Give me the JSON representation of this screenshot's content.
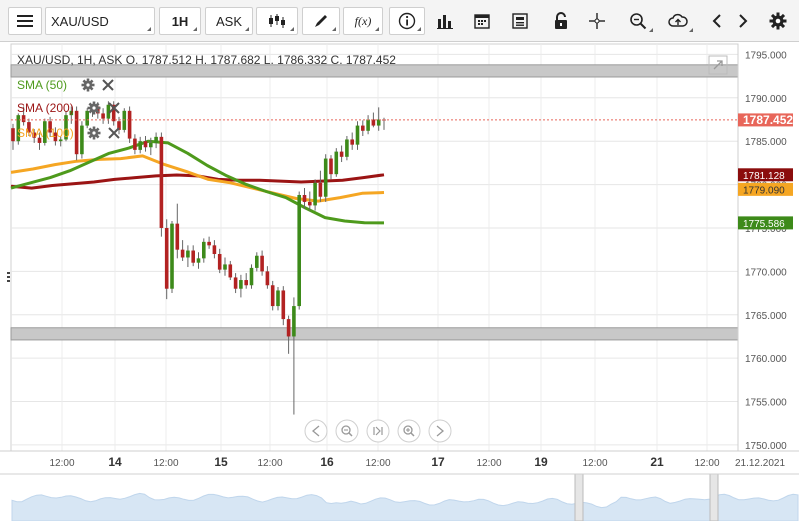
{
  "toolbar": {
    "symbol": "XAU/USD",
    "timeframe": "1H",
    "price_type": "ASK",
    "fx_label": "f(x)",
    "icons": [
      "menu-icon",
      "candles-icon",
      "pencil-icon",
      "function-icon",
      "info-icon",
      "bar-chart-icon",
      "calendar-icon",
      "news-icon",
      "lock-icon",
      "crosshair-icon",
      "zoom-icon",
      "cloud-upload-icon",
      "chevron-left-icon",
      "chevron-right-icon",
      "gear-icon"
    ]
  },
  "chart": {
    "header": "XAU/USD, 1H, ASK",
    "ohlc": "O. 1787.512 H. 1787.682 L. 1786.332 C. 1787.452",
    "indicators": [
      {
        "label": "SMA (50)",
        "color": "#4e9a1c"
      },
      {
        "label": "SMA (200)",
        "color": "#9b1414"
      },
      {
        "label": "SMA (100)",
        "color": "#f5a623"
      }
    ],
    "price_badges": [
      {
        "value": "1787.452",
        "bg": "#e8665a",
        "fg": "#ffffff"
      },
      {
        "value": "1781.128",
        "bg": "#8b0d0d",
        "fg": "#ffffff"
      },
      {
        "value": "1779.090",
        "bg": "#f5a623",
        "fg": "#333333"
      },
      {
        "value": "1775.586",
        "bg": "#3d8a1a",
        "fg": "#ffffff"
      }
    ],
    "y_ticks": [
      "1795.000",
      "1790.000",
      "1785.000",
      "1780.000",
      "1775.000",
      "1770.000",
      "1765.000",
      "1760.000",
      "1755.000",
      "1750.000"
    ],
    "x_ticks": [
      {
        "label": "12:00",
        "bold": false
      },
      {
        "label": "14",
        "bold": true
      },
      {
        "label": "12:00",
        "bold": false
      },
      {
        "label": "15",
        "bold": true
      },
      {
        "label": "12:00",
        "bold": false
      },
      {
        "label": "16",
        "bold": true
      },
      {
        "label": "12:00",
        "bold": false
      },
      {
        "label": "17",
        "bold": true
      },
      {
        "label": "12:00",
        "bold": false
      },
      {
        "label": "19",
        "bold": true
      },
      {
        "label": "12:00",
        "bold": false
      },
      {
        "label": "21",
        "bold": true
      },
      {
        "label": "12:00",
        "bold": false
      },
      {
        "label": "21.12.2021",
        "bold": false
      }
    ]
  },
  "chart_data": {
    "type": "candlestick",
    "symbol": "XAU/USD",
    "interval": "1H",
    "ylim": [
      1750,
      1796
    ],
    "bullish_color": "#3d8a1a",
    "bearish_color": "#b22222",
    "candles": [
      [
        1786.5,
        1787.0,
        1784.0,
        1785.0
      ],
      [
        1785.0,
        1788.2,
        1784.6,
        1788.0
      ],
      [
        1788.0,
        1789.0,
        1786.8,
        1787.2
      ],
      [
        1787.2,
        1787.6,
        1785.6,
        1786.0
      ],
      [
        1786.0,
        1786.4,
        1784.8,
        1785.4
      ],
      [
        1785.4,
        1786.0,
        1784.0,
        1784.8
      ],
      [
        1784.8,
        1787.6,
        1784.5,
        1787.3
      ],
      [
        1787.3,
        1787.8,
        1785.5,
        1786.0
      ],
      [
        1786.0,
        1786.6,
        1784.5,
        1785.0
      ],
      [
        1785.0,
        1785.5,
        1784.4,
        1785.2
      ],
      [
        1785.2,
        1788.5,
        1785.0,
        1788.0
      ],
      [
        1788.0,
        1789.0,
        1787.0,
        1788.5
      ],
      [
        1788.5,
        1789.0,
        1782.8,
        1783.5
      ],
      [
        1783.5,
        1787.3,
        1783.0,
        1786.8
      ],
      [
        1786.8,
        1788.8,
        1786.5,
        1788.5
      ],
      [
        1788.5,
        1789.3,
        1787.8,
        1789.0
      ],
      [
        1789.0,
        1789.5,
        1787.6,
        1788.2
      ],
      [
        1788.2,
        1788.8,
        1787.0,
        1787.6
      ],
      [
        1787.6,
        1789.6,
        1787.0,
        1789.2
      ],
      [
        1789.2,
        1789.6,
        1786.8,
        1787.3
      ],
      [
        1787.3,
        1787.8,
        1785.8,
        1786.3
      ],
      [
        1786.3,
        1788.8,
        1786.0,
        1788.5
      ],
      [
        1788.5,
        1789.0,
        1784.8,
        1785.3
      ],
      [
        1785.3,
        1785.8,
        1783.5,
        1784.0
      ],
      [
        1784.0,
        1785.5,
        1783.6,
        1785.0
      ],
      [
        1785.0,
        1785.6,
        1783.8,
        1784.3
      ],
      [
        1784.3,
        1785.4,
        1783.4,
        1784.8
      ],
      [
        1784.8,
        1786.0,
        1784.2,
        1785.5
      ],
      [
        1785.5,
        1786.0,
        1774.0,
        1775.0
      ],
      [
        1775.0,
        1776.0,
        1766.8,
        1768.0
      ],
      [
        1768.0,
        1775.8,
        1767.5,
        1775.5
      ],
      [
        1775.5,
        1777.8,
        1771.5,
        1772.5
      ],
      [
        1772.5,
        1773.6,
        1771.2,
        1771.6
      ],
      [
        1771.6,
        1773.0,
        1770.5,
        1772.4
      ],
      [
        1772.4,
        1773.0,
        1770.6,
        1771.0
      ],
      [
        1771.0,
        1772.2,
        1770.3,
        1771.5
      ],
      [
        1771.5,
        1773.8,
        1771.0,
        1773.4
      ],
      [
        1773.4,
        1774.0,
        1772.6,
        1773.0
      ],
      [
        1773.0,
        1773.6,
        1771.5,
        1772.0
      ],
      [
        1772.0,
        1772.6,
        1769.8,
        1770.2
      ],
      [
        1770.2,
        1771.6,
        1769.5,
        1770.8
      ],
      [
        1770.8,
        1771.2,
        1769.0,
        1769.3
      ],
      [
        1769.3,
        1769.8,
        1767.5,
        1768.0
      ],
      [
        1768.0,
        1769.6,
        1767.0,
        1769.0
      ],
      [
        1769.0,
        1769.8,
        1768.0,
        1768.4
      ],
      [
        1768.4,
        1770.8,
        1768.0,
        1770.4
      ],
      [
        1770.4,
        1772.2,
        1770.0,
        1771.8
      ],
      [
        1771.8,
        1772.4,
        1769.5,
        1770.0
      ],
      [
        1770.0,
        1770.6,
        1768.0,
        1768.4
      ],
      [
        1768.4,
        1768.9,
        1765.5,
        1766.0
      ],
      [
        1766.0,
        1768.2,
        1765.5,
        1767.8
      ],
      [
        1767.8,
        1768.3,
        1763.8,
        1764.5
      ],
      [
        1764.5,
        1764.9,
        1760.5,
        1762.5
      ],
      [
        1762.5,
        1767.0,
        1753.5,
        1766.0
      ],
      [
        1766.0,
        1779.2,
        1765.6,
        1778.8
      ],
      [
        1778.8,
        1779.6,
        1777.2,
        1778.0
      ],
      [
        1778.0,
        1779.2,
        1777.0,
        1777.6
      ],
      [
        1777.6,
        1780.6,
        1777.0,
        1780.2
      ],
      [
        1780.2,
        1781.6,
        1778.0,
        1778.6
      ],
      [
        1778.6,
        1783.5,
        1778.0,
        1783.0
      ],
      [
        1783.0,
        1783.4,
        1780.6,
        1781.2
      ],
      [
        1781.2,
        1784.2,
        1780.9,
        1783.8
      ],
      [
        1783.8,
        1784.5,
        1782.6,
        1783.2
      ],
      [
        1783.2,
        1785.6,
        1782.8,
        1785.2
      ],
      [
        1785.2,
        1786.0,
        1784.0,
        1784.6
      ],
      [
        1784.6,
        1787.3,
        1784.0,
        1786.8
      ],
      [
        1786.8,
        1787.4,
        1785.6,
        1786.2
      ],
      [
        1786.2,
        1788.0,
        1785.8,
        1787.5
      ],
      [
        1787.5,
        1788.3,
        1786.6,
        1786.8
      ],
      [
        1786.8,
        1788.9,
        1786.2,
        1787.5
      ],
      [
        1787.5,
        1787.7,
        1786.3,
        1787.452
      ]
    ],
    "sma_50": [
      1779.6,
      1780.2,
      1780.8,
      1781.6,
      1782.6,
      1783.6,
      1784.2,
      1785.0,
      1784.8,
      1783.6,
      1782.2,
      1781.0,
      1780.0,
      1779.2,
      1778.5,
      1777.3,
      1776.2,
      1775.8,
      1775.6,
      1775.586
    ],
    "sma_100": [
      1781.4,
      1781.8,
      1782.3,
      1782.7,
      1782.9,
      1783.0,
      1783.3,
      1782.3,
      1781.5,
      1780.6,
      1780.2,
      1779.6,
      1779.0,
      1778.4,
      1778.1,
      1778.5,
      1779.0,
      1779.09
    ],
    "sma_200": [
      1779.8,
      1779.6,
      1779.9,
      1780.1,
      1780.3,
      1780.6,
      1780.8,
      1781.0,
      1781.1,
      1781.0,
      1780.6,
      1780.5,
      1780.5,
      1780.4,
      1780.3,
      1780.4,
      1780.5,
      1780.8,
      1781.128
    ],
    "horizontal_zones": [
      [
        1792.4,
        1793.8
      ],
      [
        1762.1,
        1763.5
      ]
    ],
    "current_price": 1787.452
  }
}
